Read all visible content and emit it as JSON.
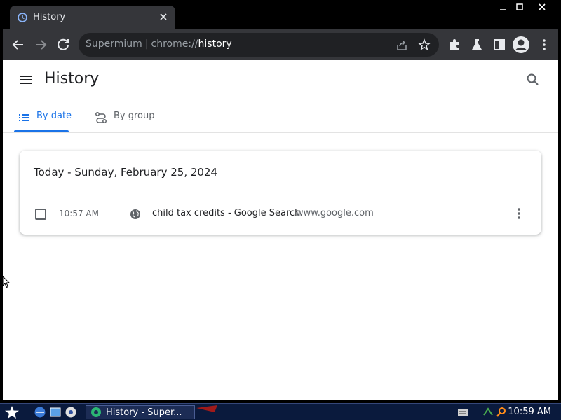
{
  "browser": {
    "tab_title": "History",
    "omnibox": {
      "app_name": "Supermium",
      "url_scheme": "chrome://",
      "url_host": "history"
    }
  },
  "history_page": {
    "title": "History",
    "tabs": [
      {
        "label": "By date",
        "selected": true
      },
      {
        "label": "By group",
        "selected": false
      }
    ],
    "day_card": {
      "heading": "Today - Sunday, February 25, 2024",
      "entries": [
        {
          "time": "10:57 AM",
          "title": "child tax credits - Google Search",
          "domain": "www.google.com"
        }
      ]
    }
  },
  "taskbar": {
    "task_label": "History - Super...",
    "clock": "10:59 AM"
  },
  "colors": {
    "accent": "#1a73e8",
    "toolbar": "#35363a",
    "omnibox": "#202124",
    "taskbar": "#0a1a3d"
  }
}
